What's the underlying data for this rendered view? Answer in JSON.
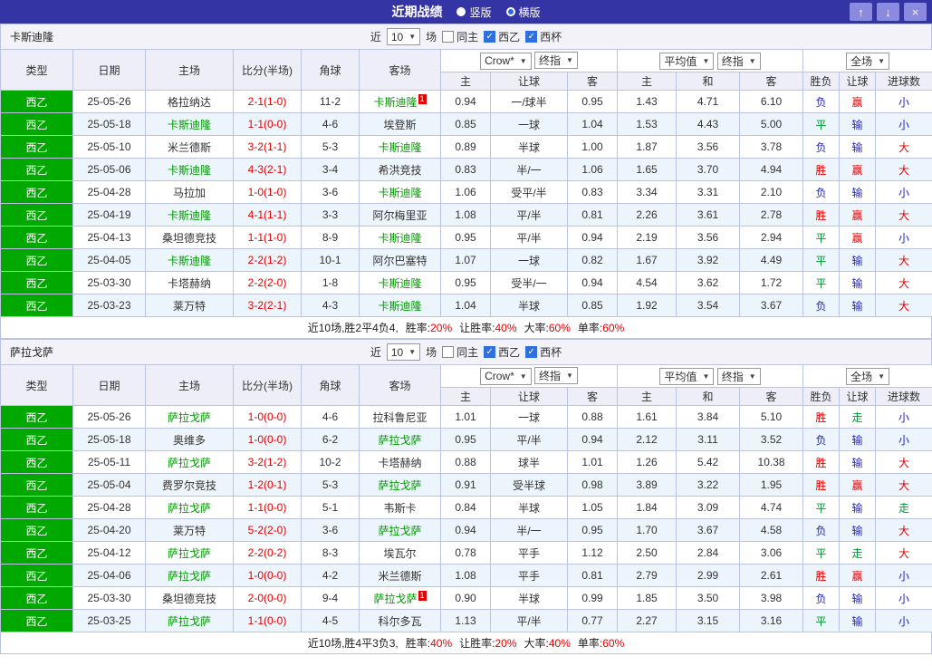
{
  "icons": {
    "up": "↑",
    "down": "↓",
    "close": "×",
    "dropdown": "▼",
    "check": "✓"
  },
  "colors": {
    "topbar_bg": "#3434a4",
    "focal_team": "#009900",
    "score": "#e60000",
    "league_bg": "#00a800",
    "stat_value": "#e60000",
    "outcome": {
      "胜": "#e60000",
      "赢": "#e60000",
      "大": "#e60000",
      "负": "#2323c8",
      "输": "#2323c8",
      "小": "#2323c8",
      "平": "#009933",
      "走": "#009933"
    }
  },
  "topbar": {
    "title": "近期战绩",
    "radios": [
      {
        "label": "竖版",
        "selected": false
      },
      {
        "label": "横版",
        "selected": true
      }
    ]
  },
  "filter": {
    "near_label": "近",
    "count_value": "10",
    "matches_label": "场",
    "checkboxes": [
      {
        "label": "同主",
        "checked": false
      },
      {
        "label": "西乙",
        "checked": true
      },
      {
        "label": "西杯",
        "checked": true
      }
    ]
  },
  "table_header": {
    "type": "类型",
    "date": "日期",
    "home": "主场",
    "score": "比分(半场)",
    "corner": "角球",
    "away": "客场",
    "odds_selects": [
      {
        "value": "Crow*"
      },
      {
        "value": "终指"
      }
    ],
    "avg_selects": [
      {
        "value": "平均值"
      },
      {
        "value": "终指"
      }
    ],
    "result_select": {
      "value": "全场"
    },
    "odds_home": "主",
    "odds_handicap": "让球",
    "odds_away": "客",
    "avg_home": "主",
    "avg_draw": "和",
    "avg_away": "客",
    "result": "胜负",
    "handicap_result": "让球",
    "goals": "进球数"
  },
  "sections": [
    {
      "team": "卡斯迪隆",
      "rows": [
        {
          "league": "西乙",
          "date": "25-05-26",
          "home": "格拉纳达",
          "home_focal": false,
          "home_card": "",
          "score": "2-1(1-0)",
          "corner": "11-2",
          "away": "卡斯迪隆",
          "away_focal": true,
          "away_card": "1",
          "odds": [
            "0.94",
            "一/球半",
            "0.95"
          ],
          "avg": [
            "1.43",
            "4.71",
            "6.10"
          ],
          "result": "负",
          "asian": "赢",
          "goals": "小"
        },
        {
          "league": "西乙",
          "date": "25-05-18",
          "home": "卡斯迪隆",
          "home_focal": true,
          "home_card": "",
          "score": "1-1(0-0)",
          "corner": "4-6",
          "away": "埃登斯",
          "away_focal": false,
          "away_card": "",
          "odds": [
            "0.85",
            "一球",
            "1.04"
          ],
          "avg": [
            "1.53",
            "4.43",
            "5.00"
          ],
          "result": "平",
          "asian": "输",
          "goals": "小"
        },
        {
          "league": "西乙",
          "date": "25-05-10",
          "home": "米兰德斯",
          "home_focal": false,
          "home_card": "",
          "score": "3-2(1-1)",
          "corner": "5-3",
          "away": "卡斯迪隆",
          "away_focal": true,
          "away_card": "",
          "odds": [
            "0.89",
            "半球",
            "1.00"
          ],
          "avg": [
            "1.87",
            "3.56",
            "3.78"
          ],
          "result": "负",
          "asian": "输",
          "goals": "大"
        },
        {
          "league": "西乙",
          "date": "25-05-06",
          "home": "卡斯迪隆",
          "home_focal": true,
          "home_card": "",
          "score": "4-3(2-1)",
          "corner": "3-4",
          "away": "希洪竞技",
          "away_focal": false,
          "away_card": "",
          "odds": [
            "0.83",
            "半/一",
            "1.06"
          ],
          "avg": [
            "1.65",
            "3.70",
            "4.94"
          ],
          "result": "胜",
          "asian": "赢",
          "goals": "大"
        },
        {
          "league": "西乙",
          "date": "25-04-28",
          "home": "马拉加",
          "home_focal": false,
          "home_card": "",
          "score": "1-0(1-0)",
          "corner": "3-6",
          "away": "卡斯迪隆",
          "away_focal": true,
          "away_card": "",
          "odds": [
            "1.06",
            "受平/半",
            "0.83"
          ],
          "avg": [
            "3.34",
            "3.31",
            "2.10"
          ],
          "result": "负",
          "asian": "输",
          "goals": "小"
        },
        {
          "league": "西乙",
          "date": "25-04-19",
          "home": "卡斯迪隆",
          "home_focal": true,
          "home_card": "",
          "score": "4-1(1-1)",
          "corner": "3-3",
          "away": "阿尔梅里亚",
          "away_focal": false,
          "away_card": "",
          "odds": [
            "1.08",
            "平/半",
            "0.81"
          ],
          "avg": [
            "2.26",
            "3.61",
            "2.78"
          ],
          "result": "胜",
          "asian": "赢",
          "goals": "大"
        },
        {
          "league": "西乙",
          "date": "25-04-13",
          "home": "桑坦德竞技",
          "home_focal": false,
          "home_card": "",
          "score": "1-1(1-0)",
          "corner": "8-9",
          "away": "卡斯迪隆",
          "away_focal": true,
          "away_card": "",
          "odds": [
            "0.95",
            "平/半",
            "0.94"
          ],
          "avg": [
            "2.19",
            "3.56",
            "2.94"
          ],
          "result": "平",
          "asian": "赢",
          "goals": "小"
        },
        {
          "league": "西乙",
          "date": "25-04-05",
          "home": "卡斯迪隆",
          "home_focal": true,
          "home_card": "",
          "score": "2-2(1-2)",
          "corner": "10-1",
          "away": "阿尔巴塞特",
          "away_focal": false,
          "away_card": "",
          "odds": [
            "1.07",
            "一球",
            "0.82"
          ],
          "avg": [
            "1.67",
            "3.92",
            "4.49"
          ],
          "result": "平",
          "asian": "输",
          "goals": "大"
        },
        {
          "league": "西乙",
          "date": "25-03-30",
          "home": "卡塔赫纳",
          "home_focal": false,
          "home_card": "",
          "score": "2-2(2-0)",
          "corner": "1-8",
          "away": "卡斯迪隆",
          "away_focal": true,
          "away_card": "",
          "odds": [
            "0.95",
            "受半/一",
            "0.94"
          ],
          "avg": [
            "4.54",
            "3.62",
            "1.72"
          ],
          "result": "平",
          "asian": "输",
          "goals": "大"
        },
        {
          "league": "西乙",
          "date": "25-03-23",
          "home": "莱万特",
          "home_focal": false,
          "home_card": "",
          "score": "3-2(2-1)",
          "corner": "4-3",
          "away": "卡斯迪隆",
          "away_focal": true,
          "away_card": "",
          "odds": [
            "1.04",
            "半球",
            "0.85"
          ],
          "avg": [
            "1.92",
            "3.54",
            "3.67"
          ],
          "result": "负",
          "asian": "输",
          "goals": "大"
        }
      ],
      "summary": {
        "prefix": "近10场,胜2平4负4,",
        "stats": [
          {
            "label": "胜率:",
            "value": "20%"
          },
          {
            "label": "让胜率:",
            "value": "40%"
          },
          {
            "label": "大率:",
            "value": "60%"
          },
          {
            "label": "单率:",
            "value": "60%"
          }
        ]
      }
    },
    {
      "team": "萨拉戈萨",
      "rows": [
        {
          "league": "西乙",
          "date": "25-05-26",
          "home": "萨拉戈萨",
          "home_focal": true,
          "home_card": "",
          "score": "1-0(0-0)",
          "corner": "4-6",
          "away": "拉科鲁尼亚",
          "away_focal": false,
          "away_card": "",
          "odds": [
            "1.01",
            "一球",
            "0.88"
          ],
          "avg": [
            "1.61",
            "3.84",
            "5.10"
          ],
          "result": "胜",
          "asian": "走",
          "goals": "小"
        },
        {
          "league": "西乙",
          "date": "25-05-18",
          "home": "奥维多",
          "home_focal": false,
          "home_card": "",
          "score": "1-0(0-0)",
          "corner": "6-2",
          "away": "萨拉戈萨",
          "away_focal": true,
          "away_card": "",
          "odds": [
            "0.95",
            "平/半",
            "0.94"
          ],
          "avg": [
            "2.12",
            "3.11",
            "3.52"
          ],
          "result": "负",
          "asian": "输",
          "goals": "小"
        },
        {
          "league": "西乙",
          "date": "25-05-11",
          "home": "萨拉戈萨",
          "home_focal": true,
          "home_card": "",
          "score": "3-2(1-2)",
          "corner": "10-2",
          "away": "卡塔赫纳",
          "away_focal": false,
          "away_card": "",
          "odds": [
            "0.88",
            "球半",
            "1.01"
          ],
          "avg": [
            "1.26",
            "5.42",
            "10.38"
          ],
          "result": "胜",
          "asian": "输",
          "goals": "大"
        },
        {
          "league": "西乙",
          "date": "25-05-04",
          "home": "费罗尔竞技",
          "home_focal": false,
          "home_card": "",
          "score": "1-2(0-1)",
          "corner": "5-3",
          "away": "萨拉戈萨",
          "away_focal": true,
          "away_card": "",
          "odds": [
            "0.91",
            "受半球",
            "0.98"
          ],
          "avg": [
            "3.89",
            "3.22",
            "1.95"
          ],
          "result": "胜",
          "asian": "赢",
          "goals": "大"
        },
        {
          "league": "西乙",
          "date": "25-04-28",
          "home": "萨拉戈萨",
          "home_focal": true,
          "home_card": "",
          "score": "1-1(0-0)",
          "corner": "5-1",
          "away": "韦斯卡",
          "away_focal": false,
          "away_card": "",
          "odds": [
            "0.84",
            "半球",
            "1.05"
          ],
          "avg": [
            "1.84",
            "3.09",
            "4.74"
          ],
          "result": "平",
          "asian": "输",
          "goals": "走"
        },
        {
          "league": "西乙",
          "date": "25-04-20",
          "home": "莱万特",
          "home_focal": false,
          "home_card": "",
          "score": "5-2(2-0)",
          "corner": "3-6",
          "away": "萨拉戈萨",
          "away_focal": true,
          "away_card": "",
          "odds": [
            "0.94",
            "半/一",
            "0.95"
          ],
          "avg": [
            "1.70",
            "3.67",
            "4.58"
          ],
          "result": "负",
          "asian": "输",
          "goals": "大"
        },
        {
          "league": "西乙",
          "date": "25-04-12",
          "home": "萨拉戈萨",
          "home_focal": true,
          "home_card": "",
          "score": "2-2(0-2)",
          "corner": "8-3",
          "away": "埃瓦尔",
          "away_focal": false,
          "away_card": "",
          "odds": [
            "0.78",
            "平手",
            "1.12"
          ],
          "avg": [
            "2.50",
            "2.84",
            "3.06"
          ],
          "result": "平",
          "asian": "走",
          "goals": "大"
        },
        {
          "league": "西乙",
          "date": "25-04-06",
          "home": "萨拉戈萨",
          "home_focal": true,
          "home_card": "",
          "score": "1-0(0-0)",
          "corner": "4-2",
          "away": "米兰德斯",
          "away_focal": false,
          "away_card": "",
          "odds": [
            "1.08",
            "平手",
            "0.81"
          ],
          "avg": [
            "2.79",
            "2.99",
            "2.61"
          ],
          "result": "胜",
          "asian": "赢",
          "goals": "小"
        },
        {
          "league": "西乙",
          "date": "25-03-30",
          "home": "桑坦德竞技",
          "home_focal": false,
          "home_card": "",
          "score": "2-0(0-0)",
          "corner": "9-4",
          "away": "萨拉戈萨",
          "away_focal": true,
          "away_card": "1",
          "odds": [
            "0.90",
            "半球",
            "0.99"
          ],
          "avg": [
            "1.85",
            "3.50",
            "3.98"
          ],
          "result": "负",
          "asian": "输",
          "goals": "小"
        },
        {
          "league": "西乙",
          "date": "25-03-25",
          "home": "萨拉戈萨",
          "home_focal": true,
          "home_card": "",
          "score": "1-1(0-0)",
          "corner": "4-5",
          "away": "科尔多瓦",
          "away_focal": false,
          "away_card": "",
          "odds": [
            "1.13",
            "平/半",
            "0.77"
          ],
          "avg": [
            "2.27",
            "3.15",
            "3.16"
          ],
          "result": "平",
          "asian": "输",
          "goals": "小"
        }
      ],
      "summary": {
        "prefix": "近10场,胜4平3负3,",
        "stats": [
          {
            "label": "胜率:",
            "value": "40%"
          },
          {
            "label": "让胜率:",
            "value": "20%"
          },
          {
            "label": "大率:",
            "value": "40%"
          },
          {
            "label": "单率:",
            "value": "60%"
          }
        ]
      }
    }
  ]
}
